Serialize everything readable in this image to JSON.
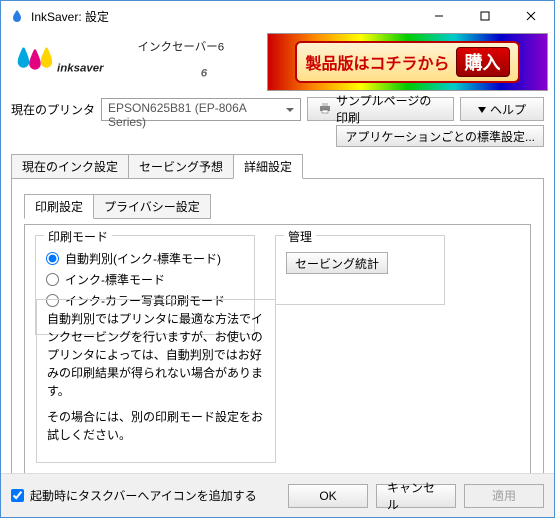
{
  "window": {
    "title": "InkSaver: 設定"
  },
  "logo": {
    "brand": "inksaver",
    "ruby": "インクセーバー6",
    "six": "6"
  },
  "ad": {
    "text": "製品版はコチラから",
    "button": "購入"
  },
  "toolbar": {
    "current_printer_label": "現在のプリンタ",
    "printer_value": "EPSON625B81 (EP-806A Series)",
    "sample_print": "サンプルページの印刷",
    "help": "ヘルプ",
    "per_app_settings": "アプリケーションごとの標準設定..."
  },
  "tabs": {
    "items": [
      {
        "label": "現在のインク設定"
      },
      {
        "label": "セービング予想"
      },
      {
        "label": "詳細設定"
      }
    ],
    "active_index": 2
  },
  "subtabs": {
    "items": [
      {
        "label": "印刷設定"
      },
      {
        "label": "プライバシー設定"
      }
    ],
    "active_index": 0
  },
  "print_mode": {
    "legend": "印刷モード",
    "options": [
      {
        "label": "自動判別(インク-標準モード)",
        "checked": true
      },
      {
        "label": "インク-標準モード",
        "checked": false
      },
      {
        "label": "インク-カラー写真印刷モード",
        "checked": false
      }
    ]
  },
  "management": {
    "legend": "管理",
    "stats_button": "セービング統計"
  },
  "info": {
    "p1": "自動判別ではプリンタに最適な方法でインクセービングを行いますが、お使いのプリンタによっては、自動判別ではお好みの印刷結果が得られない場合があります。",
    "p2": "その場合には、別の印刷モード設定をお試しください。"
  },
  "footer": {
    "startup_checkbox": "起動時にタスクバーへアイコンを追加する",
    "ok": "OK",
    "cancel": "キャンセル",
    "apply": "適用"
  }
}
